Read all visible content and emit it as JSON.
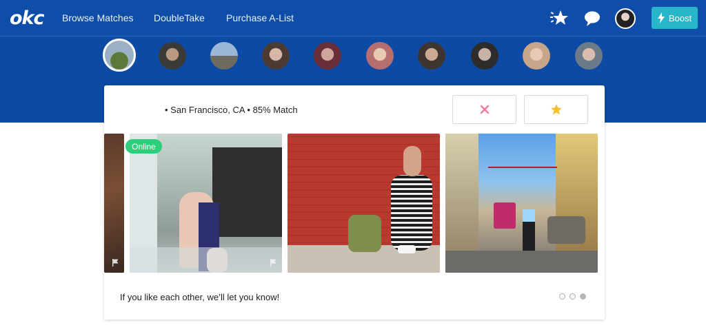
{
  "header": {
    "logo_text": "okc",
    "nav": [
      "Browse Matches",
      "DoubleTake",
      "Purchase A-List"
    ],
    "boost_label": "Boost",
    "brand_color": "#0f4ea8",
    "boost_color": "#26b5c9"
  },
  "profile_strip": {
    "count": 10,
    "selected_index": 0
  },
  "card": {
    "summary": "• San Francisco, CA • 85% Match",
    "online_badge": "Online",
    "footer_text": "If you like each other, we’ll let you know!",
    "pagination": {
      "total": 3,
      "active": 3
    },
    "actions": [
      "close-icon",
      "star-icon"
    ]
  }
}
